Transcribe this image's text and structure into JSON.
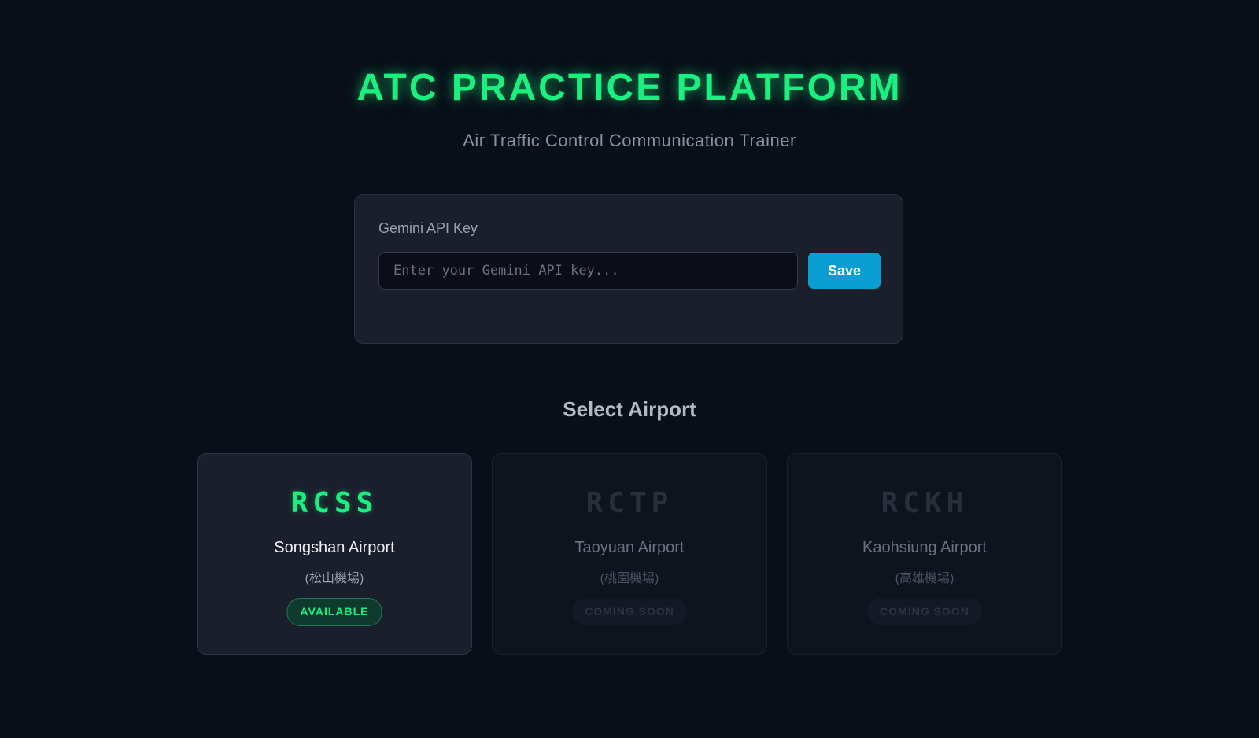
{
  "header": {
    "title": "ATC PRACTICE PLATFORM",
    "subtitle": "Air Traffic Control Communication Trainer"
  },
  "api_key": {
    "label": "Gemini API Key",
    "value": "",
    "placeholder": "Enter your Gemini API key...",
    "save_label": "Save"
  },
  "airports": {
    "section_title": "Select Airport",
    "items": [
      {
        "code": "RCSS",
        "name": "Songshan Airport",
        "local_name": "(松山機場)",
        "status": "AVAILABLE"
      },
      {
        "code": "RCTP",
        "name": "Taoyuan Airport",
        "local_name": "(桃園機場)",
        "status": "COMING SOON"
      },
      {
        "code": "RCKH",
        "name": "Kaohsiung Airport",
        "local_name": "(高雄機場)",
        "status": "COMING SOON"
      }
    ]
  },
  "colors": {
    "background": "#0a0e19",
    "accent_green": "#1af07f",
    "button_blue": "#0b9ed3",
    "panel": "#1b1e2b"
  }
}
